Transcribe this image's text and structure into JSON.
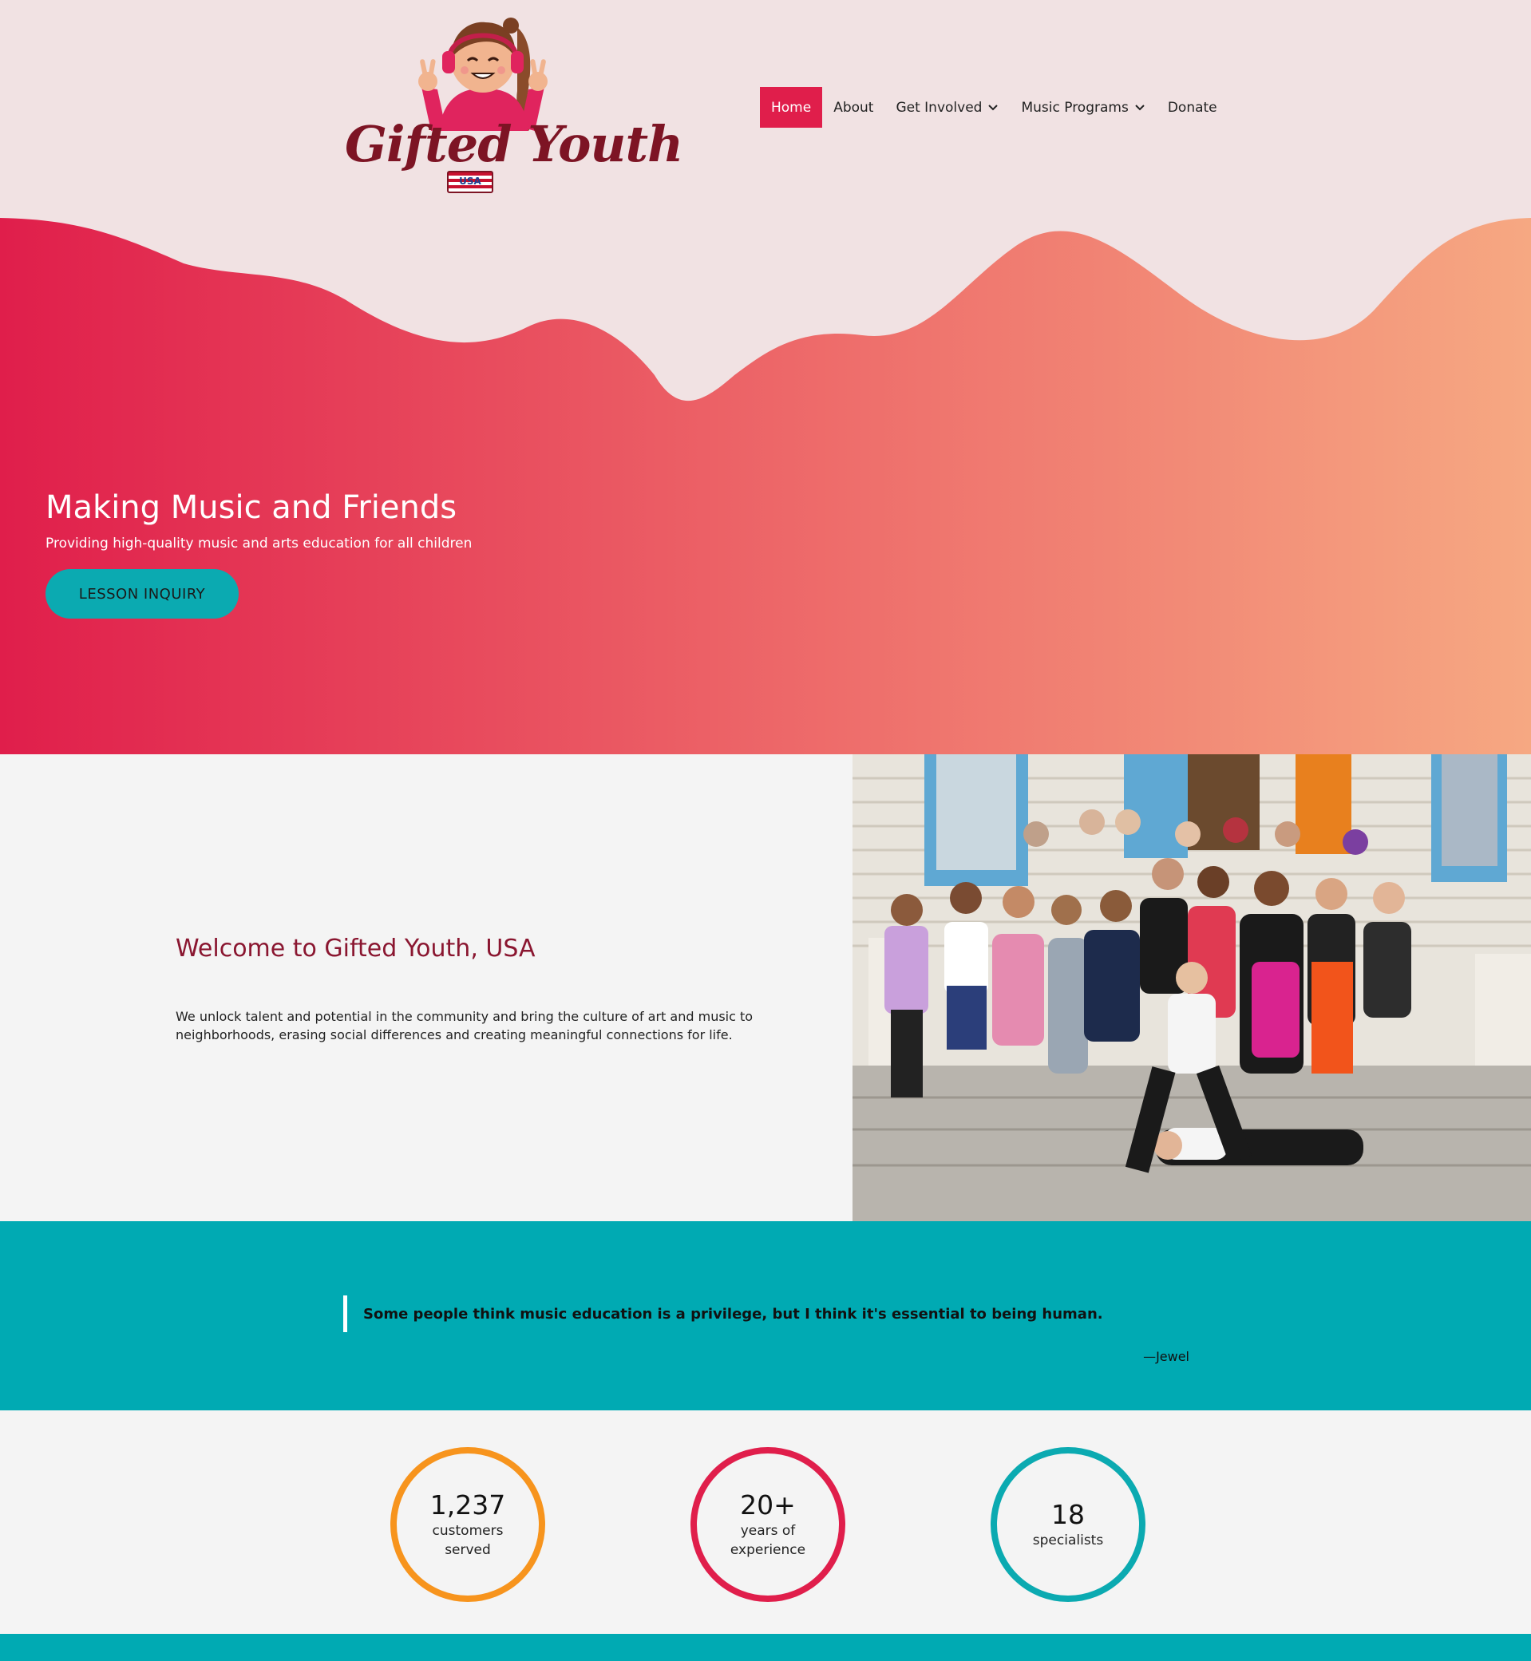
{
  "brand": {
    "logo_text": "Gifted Youth",
    "logo_badge": "USA"
  },
  "nav": {
    "items": [
      {
        "label": "Home",
        "active": true
      },
      {
        "label": "About"
      },
      {
        "label": "Get Involved",
        "dropdown": true
      },
      {
        "label": "Music Programs",
        "dropdown": true
      },
      {
        "label": "Donate"
      }
    ]
  },
  "hero": {
    "title": "Making Music and Friends",
    "subtitle": "Providing high-quality music and arts education for all children",
    "cta_label": "LESSON INQUIRY"
  },
  "welcome": {
    "title": "Welcome to Gifted Youth, USA",
    "body": "We unlock talent and potential in the community and bring the culture of art and music to neighborhoods, erasing social differences and creating meaningful connections for life."
  },
  "quote": {
    "text": "Some people think music education is a privilege, but I think it's essential to being human.",
    "author": "—Jewel"
  },
  "stats": [
    {
      "value": "1,237",
      "label": "customers served",
      "color": "#f7941d"
    },
    {
      "value": "20+",
      "label": "years of experience",
      "color": "#e01e4b"
    },
    {
      "value": "18",
      "label": "specialists",
      "color": "#0baab1"
    }
  ],
  "colors": {
    "primary": "#e01e4b",
    "teal": "#00aab3",
    "header_bg": "#f1e2e3",
    "welcome_title": "#8a1630"
  }
}
